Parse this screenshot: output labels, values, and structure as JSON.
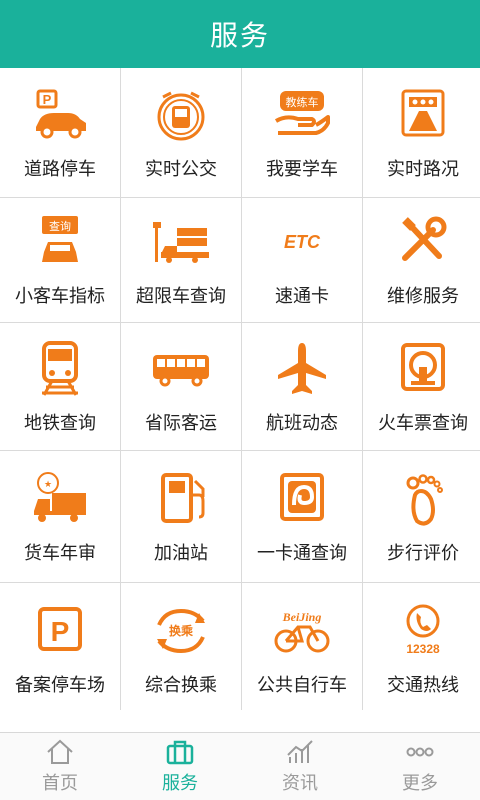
{
  "header": {
    "title": "服务"
  },
  "accent_color": "#1ab19b",
  "icon_color": "#f07c1a",
  "services": [
    {
      "label": "道路停车",
      "icon": "parking-car-icon"
    },
    {
      "label": "实时公交",
      "icon": "bus-clock-icon"
    },
    {
      "label": "我要学车",
      "icon": "driving-school-icon",
      "icon_text": "教练车"
    },
    {
      "label": "实时路况",
      "icon": "traffic-road-icon"
    },
    {
      "label": "小客车指标",
      "icon": "car-query-icon",
      "icon_text": "查询"
    },
    {
      "label": "超限车查询",
      "icon": "overload-truck-icon"
    },
    {
      "label": "速通卡",
      "icon": "etc-icon",
      "icon_text": "ETC"
    },
    {
      "label": "维修服务",
      "icon": "repair-tools-icon"
    },
    {
      "label": "地铁查询",
      "icon": "subway-icon"
    },
    {
      "label": "省际客运",
      "icon": "coach-bus-icon"
    },
    {
      "label": "航班动态",
      "icon": "airplane-icon"
    },
    {
      "label": "火车票查询",
      "icon": "train-ticket-icon"
    },
    {
      "label": "货车年审",
      "icon": "truck-inspection-icon"
    },
    {
      "label": "加油站",
      "icon": "gas-station-icon"
    },
    {
      "label": "一卡通查询",
      "icon": "transit-card-icon"
    },
    {
      "label": "步行评价",
      "icon": "footprint-icon"
    },
    {
      "label": "备案停车场",
      "icon": "parking-lot-icon"
    },
    {
      "label": "综合换乘",
      "icon": "transfer-icon",
      "icon_text": "换乘"
    },
    {
      "label": "公共自行车",
      "icon": "bicycle-icon",
      "icon_text": "BeiJing"
    },
    {
      "label": "交通热线",
      "icon": "hotline-icon",
      "icon_text": "12328"
    }
  ],
  "tabs": [
    {
      "label": "首页",
      "icon": "home-icon",
      "active": false
    },
    {
      "label": "服务",
      "icon": "briefcase-icon",
      "active": true
    },
    {
      "label": "资讯",
      "icon": "news-chart-icon",
      "active": false
    },
    {
      "label": "更多",
      "icon": "more-dots-icon",
      "active": false
    }
  ]
}
